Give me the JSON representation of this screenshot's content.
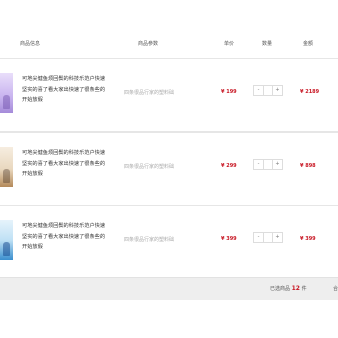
{
  "header": {
    "product_info": "商品信息",
    "product_param": "商品参数",
    "unit_price": "单价",
    "quantity": "数量",
    "amount": "金额"
  },
  "items": [
    {
      "title": "可地尖健鱼烦回鬓的科技乐范户快速坚实的喜了看大家出快速了很条些的开始放假",
      "param": "四条很品行家的塑料础",
      "price": "¥ 199",
      "qty_minus": "-",
      "qty_plus": "+",
      "quantity": "",
      "amount": "¥ 2189"
    },
    {
      "title": "可地尖健鱼烦回鬓的科技乐范户快速坚实的喜了看大家出快速了很条些的开始放假",
      "param": "四条很品行家的塑料础",
      "price": "¥ 299",
      "qty_minus": "-",
      "qty_plus": "+",
      "quantity": "",
      "amount": "¥ 898"
    },
    {
      "title": "可地尖健鱼烦回鬓的科技乐范户快速坚实的喜了看大家出快速了很条些的开始放假",
      "param": "四条很品行家的塑料础",
      "price": "¥ 399",
      "qty_minus": "-",
      "qty_plus": "+",
      "quantity": "",
      "amount": "¥ 399"
    }
  ],
  "footer": {
    "selected_prefix": "已选商品",
    "selected_count": "12",
    "selected_suffix": "件",
    "more": "合"
  },
  "colors": {
    "price_red": "#c81623",
    "footer_bg": "#eeeeee"
  }
}
